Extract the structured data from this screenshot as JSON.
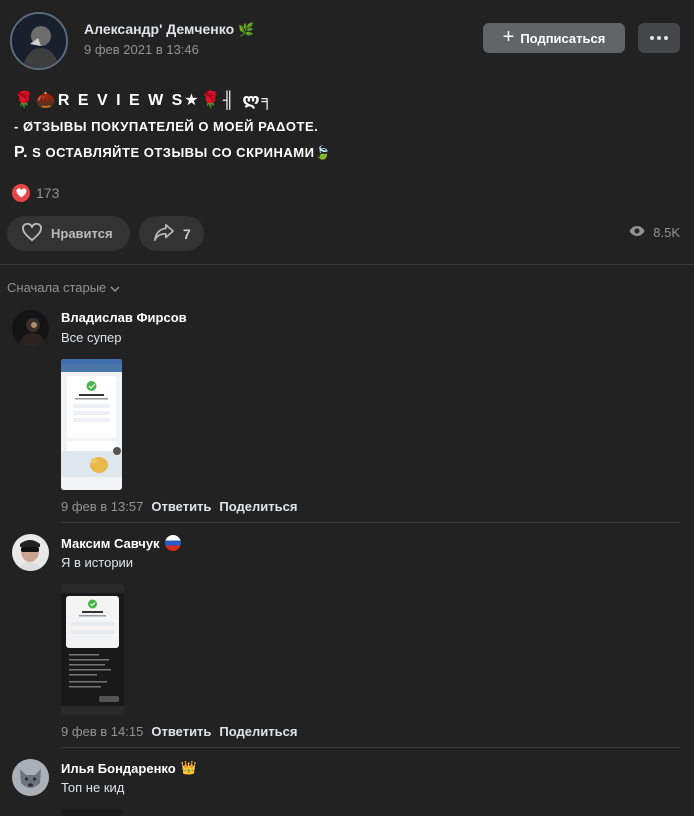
{
  "post": {
    "author": "Александр' Демченко",
    "date": "9 фев 2021 в 13:46",
    "subscribe_label": "Подписаться",
    "text": {
      "line1": "🌹🌰R E V I E W S★🌹╢ ლ╕",
      "line2": "- øтзывы покупателей о моей раδоте.",
      "line3_p": "P.",
      "line3_rest": " s оставляйте отзывы со скринами🍃"
    },
    "reactions_count": "173",
    "like_label": "Нравится",
    "share_count": "7",
    "views": "8.5K"
  },
  "comments_sort": "Сначала старые",
  "comments": [
    {
      "name": "Владислав Фирсов",
      "text": "Все супер",
      "time": "9 фев в 13:57",
      "reply": "Ответить",
      "share": "Поделиться"
    },
    {
      "name": "Максим Савчук",
      "text": "Я в истории",
      "time": "9 фев в 14:15",
      "reply": "Ответить",
      "share": "Поделиться"
    },
    {
      "name": "Илья Бондаренко",
      "text": "Топ не кид"
    }
  ],
  "colors": {
    "background": "#222222",
    "button": "#626466",
    "reaction": "#e64646"
  }
}
